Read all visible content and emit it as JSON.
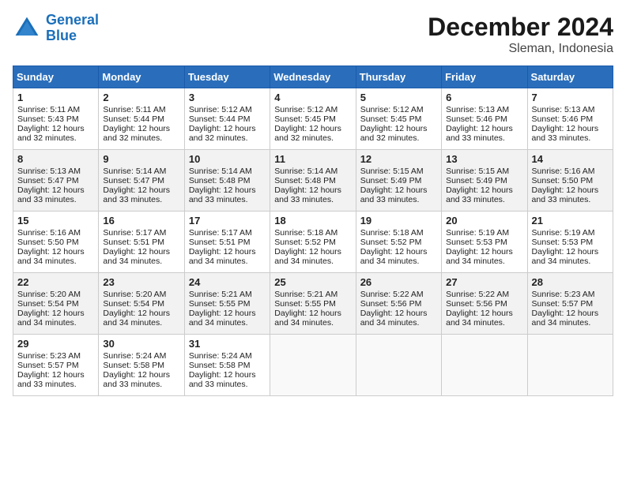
{
  "header": {
    "logo_line1": "General",
    "logo_line2": "Blue",
    "month": "December 2024",
    "location": "Sleman, Indonesia"
  },
  "weekdays": [
    "Sunday",
    "Monday",
    "Tuesday",
    "Wednesday",
    "Thursday",
    "Friday",
    "Saturday"
  ],
  "weeks": [
    [
      {
        "day": "1",
        "sunrise": "5:11 AM",
        "sunset": "5:43 PM",
        "daylight": "12 hours and 32 minutes."
      },
      {
        "day": "2",
        "sunrise": "5:11 AM",
        "sunset": "5:44 PM",
        "daylight": "12 hours and 32 minutes."
      },
      {
        "day": "3",
        "sunrise": "5:12 AM",
        "sunset": "5:44 PM",
        "daylight": "12 hours and 32 minutes."
      },
      {
        "day": "4",
        "sunrise": "5:12 AM",
        "sunset": "5:45 PM",
        "daylight": "12 hours and 32 minutes."
      },
      {
        "day": "5",
        "sunrise": "5:12 AM",
        "sunset": "5:45 PM",
        "daylight": "12 hours and 32 minutes."
      },
      {
        "day": "6",
        "sunrise": "5:13 AM",
        "sunset": "5:46 PM",
        "daylight": "12 hours and 33 minutes."
      },
      {
        "day": "7",
        "sunrise": "5:13 AM",
        "sunset": "5:46 PM",
        "daylight": "12 hours and 33 minutes."
      }
    ],
    [
      {
        "day": "8",
        "sunrise": "5:13 AM",
        "sunset": "5:47 PM",
        "daylight": "12 hours and 33 minutes."
      },
      {
        "day": "9",
        "sunrise": "5:14 AM",
        "sunset": "5:47 PM",
        "daylight": "12 hours and 33 minutes."
      },
      {
        "day": "10",
        "sunrise": "5:14 AM",
        "sunset": "5:48 PM",
        "daylight": "12 hours and 33 minutes."
      },
      {
        "day": "11",
        "sunrise": "5:14 AM",
        "sunset": "5:48 PM",
        "daylight": "12 hours and 33 minutes."
      },
      {
        "day": "12",
        "sunrise": "5:15 AM",
        "sunset": "5:49 PM",
        "daylight": "12 hours and 33 minutes."
      },
      {
        "day": "13",
        "sunrise": "5:15 AM",
        "sunset": "5:49 PM",
        "daylight": "12 hours and 33 minutes."
      },
      {
        "day": "14",
        "sunrise": "5:16 AM",
        "sunset": "5:50 PM",
        "daylight": "12 hours and 33 minutes."
      }
    ],
    [
      {
        "day": "15",
        "sunrise": "5:16 AM",
        "sunset": "5:50 PM",
        "daylight": "12 hours and 34 minutes."
      },
      {
        "day": "16",
        "sunrise": "5:17 AM",
        "sunset": "5:51 PM",
        "daylight": "12 hours and 34 minutes."
      },
      {
        "day": "17",
        "sunrise": "5:17 AM",
        "sunset": "5:51 PM",
        "daylight": "12 hours and 34 minutes."
      },
      {
        "day": "18",
        "sunrise": "5:18 AM",
        "sunset": "5:52 PM",
        "daylight": "12 hours and 34 minutes."
      },
      {
        "day": "19",
        "sunrise": "5:18 AM",
        "sunset": "5:52 PM",
        "daylight": "12 hours and 34 minutes."
      },
      {
        "day": "20",
        "sunrise": "5:19 AM",
        "sunset": "5:53 PM",
        "daylight": "12 hours and 34 minutes."
      },
      {
        "day": "21",
        "sunrise": "5:19 AM",
        "sunset": "5:53 PM",
        "daylight": "12 hours and 34 minutes."
      }
    ],
    [
      {
        "day": "22",
        "sunrise": "5:20 AM",
        "sunset": "5:54 PM",
        "daylight": "12 hours and 34 minutes."
      },
      {
        "day": "23",
        "sunrise": "5:20 AM",
        "sunset": "5:54 PM",
        "daylight": "12 hours and 34 minutes."
      },
      {
        "day": "24",
        "sunrise": "5:21 AM",
        "sunset": "5:55 PM",
        "daylight": "12 hours and 34 minutes."
      },
      {
        "day": "25",
        "sunrise": "5:21 AM",
        "sunset": "5:55 PM",
        "daylight": "12 hours and 34 minutes."
      },
      {
        "day": "26",
        "sunrise": "5:22 AM",
        "sunset": "5:56 PM",
        "daylight": "12 hours and 34 minutes."
      },
      {
        "day": "27",
        "sunrise": "5:22 AM",
        "sunset": "5:56 PM",
        "daylight": "12 hours and 34 minutes."
      },
      {
        "day": "28",
        "sunrise": "5:23 AM",
        "sunset": "5:57 PM",
        "daylight": "12 hours and 34 minutes."
      }
    ],
    [
      {
        "day": "29",
        "sunrise": "5:23 AM",
        "sunset": "5:57 PM",
        "daylight": "12 hours and 33 minutes."
      },
      {
        "day": "30",
        "sunrise": "5:24 AM",
        "sunset": "5:58 PM",
        "daylight": "12 hours and 33 minutes."
      },
      {
        "day": "31",
        "sunrise": "5:24 AM",
        "sunset": "5:58 PM",
        "daylight": "12 hours and 33 minutes."
      },
      null,
      null,
      null,
      null
    ]
  ]
}
